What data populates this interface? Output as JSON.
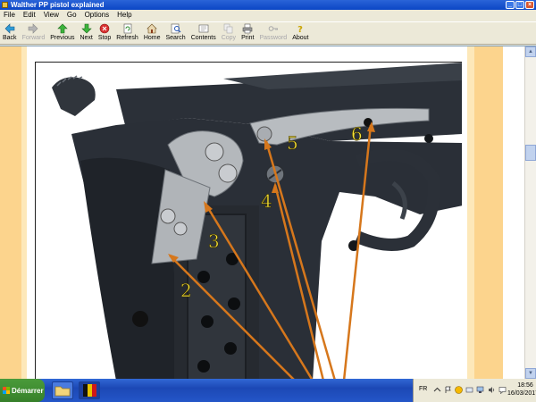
{
  "window": {
    "title": "Walther PP pistol explained"
  },
  "menu": [
    "File",
    "Edit",
    "View",
    "Go",
    "Options",
    "Help"
  ],
  "toolbar": [
    {
      "label": "Back",
      "icon": "back-arrow-icon",
      "enabled": true
    },
    {
      "label": "Forward",
      "icon": "forward-arrow-icon",
      "enabled": false
    },
    {
      "label": "Previous",
      "icon": "up-arrow-icon",
      "enabled": true
    },
    {
      "label": "Next",
      "icon": "down-arrow-icon",
      "enabled": true
    },
    {
      "label": "Stop",
      "icon": "stop-icon",
      "enabled": true
    },
    {
      "label": "Refresh",
      "icon": "refresh-icon",
      "enabled": true
    },
    {
      "label": "Home",
      "icon": "home-icon",
      "enabled": true
    },
    {
      "label": "Search",
      "icon": "search-icon",
      "enabled": true
    },
    {
      "label": "Contents",
      "icon": "contents-icon",
      "enabled": true
    },
    {
      "label": "Copy",
      "icon": "copy-icon",
      "enabled": false
    },
    {
      "label": "Print",
      "icon": "print-icon",
      "enabled": true
    },
    {
      "label": "Password",
      "icon": "key-icon",
      "enabled": false
    },
    {
      "label": "About",
      "icon": "about-icon",
      "enabled": true
    }
  ],
  "figure": {
    "callouts": [
      "2",
      "3",
      "4",
      "5",
      "6"
    ],
    "arrow_color": "#d6771c",
    "label_color": "#f6e23a"
  },
  "taskbar": {
    "start_label": "Démarrer",
    "language": "FR",
    "time": "18:56",
    "date": "16/03/2017"
  },
  "colors": {
    "titlebar": "#0b46c5",
    "page_margin": "#fcd48d",
    "taskbar": "#2456c8",
    "start_button": "#3a8a2e"
  }
}
